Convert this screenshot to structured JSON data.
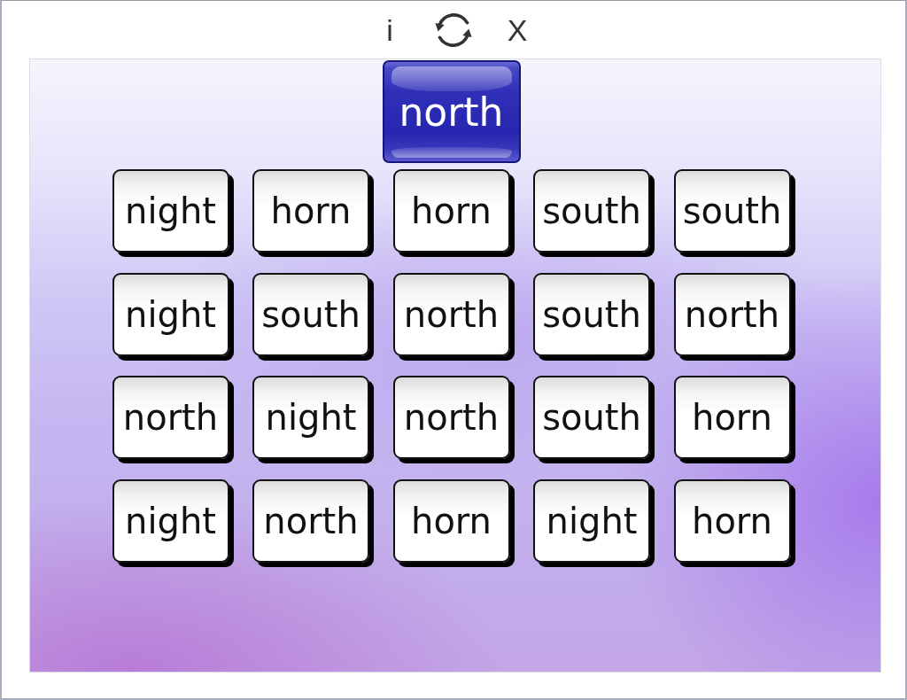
{
  "toolbar": {
    "info": "i",
    "close": "X"
  },
  "target": {
    "word": "north"
  },
  "grid": {
    "rows": [
      [
        "night",
        "horn",
        "horn",
        "south",
        "south"
      ],
      [
        "night",
        "south",
        "north",
        "south",
        "north"
      ],
      [
        "north",
        "night",
        "north",
        "south",
        "horn"
      ],
      [
        "night",
        "north",
        "horn",
        "night",
        "horn"
      ]
    ]
  }
}
